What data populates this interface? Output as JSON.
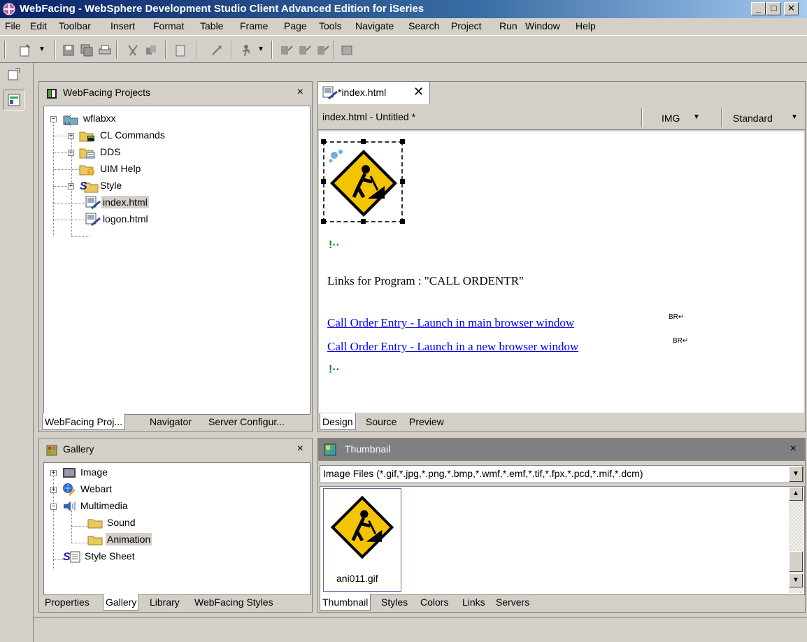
{
  "window": {
    "title": "WebFacing - WebSphere Development Studio Client Advanced Edition for iSeries",
    "minimize": "_",
    "maximize": "□",
    "close": "✕"
  },
  "menu": [
    "File",
    "Edit",
    "Toolbar",
    "Insert",
    "Format",
    "Table",
    "Frame",
    "Page",
    "Tools",
    "Navigate",
    "Search",
    "Project",
    "Run",
    "Window",
    "Help"
  ],
  "projects_panel": {
    "title": "WebFacing Projects",
    "close": "×",
    "tree": {
      "root": "wflabxx",
      "items": [
        "CL Commands",
        "DDS",
        "UIM Help",
        "Style",
        "index.html",
        "logon.html"
      ]
    },
    "tabs": [
      "WebFacing Proj...",
      "Navigator",
      "Server Configur..."
    ]
  },
  "editor": {
    "tab_label": "*index.html",
    "tab_close": "✕",
    "doc_title": "index.html - Untitled *",
    "tag_dropdown": "IMG",
    "mode_dropdown": "Standard",
    "heading": "Links for Program : \"CALL ORDENTR\"",
    "link1": "Call Order Entry - Launch in main browser window",
    "link2": "Call Order Entry - Launch in a new browser window",
    "br_marker": "BR",
    "tabs": [
      "Design",
      "Source",
      "Preview"
    ]
  },
  "gallery_panel": {
    "title": "Gallery",
    "close": "×",
    "items": [
      "Image",
      "Webart",
      "Multimedia",
      "Sound",
      "Animation",
      "Style Sheet"
    ],
    "tabs": [
      "Properties",
      "Gallery",
      "Library",
      "WebFacing Styles"
    ]
  },
  "thumbnail_panel": {
    "title": "Thumbnail",
    "close": "×",
    "filter": "Image Files (*.gif,*.jpg,*.png,*.bmp,*.wmf,*.emf,*.tif,*.fpx,*.pcd,*.mif,*.dcm)",
    "thumb_caption": "ani011.gif",
    "tabs": [
      "Thumbnail",
      "Styles",
      "Colors",
      "Links",
      "Servers"
    ]
  },
  "colors": {
    "title_bar": "#0a246a",
    "link": "#0000ee",
    "sign_yellow": "#f5c400",
    "selection": "#d4d0c8"
  }
}
